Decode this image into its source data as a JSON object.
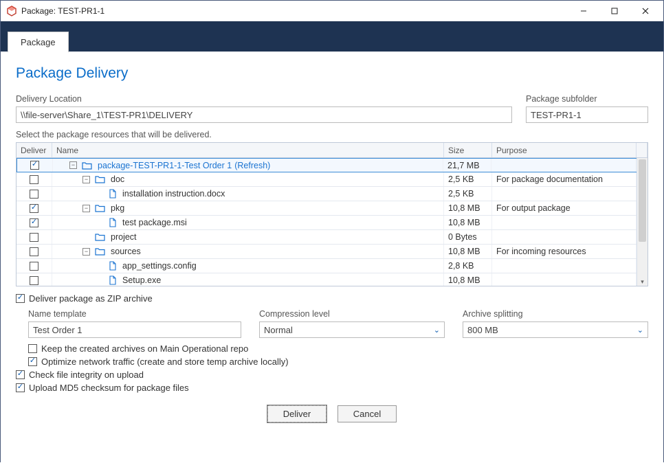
{
  "window": {
    "title": "Package: TEST-PR1-1"
  },
  "tab": {
    "label": "Package"
  },
  "page": {
    "title": "Package Delivery"
  },
  "delivery": {
    "location_label": "Delivery Location",
    "location_value": "\\\\file-server\\Share_1\\TEST-PR1\\DELIVERY",
    "subfolder_label": "Package subfolder",
    "subfolder_value": "TEST-PR1-1"
  },
  "grid": {
    "label": "Select the package resources that will be delivered.",
    "headers": {
      "deliver": "Deliver",
      "name": "Name",
      "size": "Size",
      "purpose": "Purpose"
    },
    "rows": [
      {
        "checked": true,
        "indent": 1,
        "expand": "-",
        "icon": "folder",
        "name": "package-TEST-PR1-1-Test Order 1",
        "refresh": "(Refresh)",
        "size": "21,7 MB",
        "purpose": "",
        "selected": true,
        "link": true
      },
      {
        "checked": false,
        "indent": 2,
        "expand": "-",
        "icon": "folder",
        "name": "doc",
        "size": "2,5 KB",
        "purpose": "For package documentation"
      },
      {
        "checked": false,
        "indent": 3,
        "expand": "",
        "icon": "file",
        "name": "installation instruction.docx",
        "size": "2,5 KB",
        "purpose": ""
      },
      {
        "checked": true,
        "indent": 2,
        "expand": "-",
        "icon": "folder",
        "name": "pkg",
        "size": "10,8 MB",
        "purpose": "For output package"
      },
      {
        "checked": true,
        "indent": 3,
        "expand": "",
        "icon": "file",
        "name": "test package.msi",
        "size": "10,8 MB",
        "purpose": ""
      },
      {
        "checked": false,
        "indent": 2,
        "expand": "",
        "icon": "folder",
        "name": "project",
        "size": "0 Bytes",
        "purpose": ""
      },
      {
        "checked": false,
        "indent": 2,
        "expand": "-",
        "icon": "folder",
        "name": "sources",
        "size": "10,8 MB",
        "purpose": "For incoming resources"
      },
      {
        "checked": false,
        "indent": 3,
        "expand": "",
        "icon": "file",
        "name": "app_settings.config",
        "size": "2,8 KB",
        "purpose": ""
      },
      {
        "checked": false,
        "indent": 3,
        "expand": "",
        "icon": "file",
        "name": "Setup.exe",
        "size": "10,8 MB",
        "purpose": ""
      }
    ]
  },
  "options": {
    "zip_label": "Deliver package as ZIP archive",
    "name_template_label": "Name template",
    "name_template_value": "Test Order 1",
    "compression_label": "Compression level",
    "compression_value": "Normal",
    "splitting_label": "Archive splitting",
    "splitting_value": "800 MB",
    "keep_label": "Keep the created archives on Main Operational repo",
    "optimize_label": "Optimize network traffic (create and store temp archive locally)",
    "integrity_label": "Check file integrity on upload",
    "md5_label": "Upload MD5 checksum for package files"
  },
  "buttons": {
    "deliver": "Deliver",
    "cancel": "Cancel"
  }
}
